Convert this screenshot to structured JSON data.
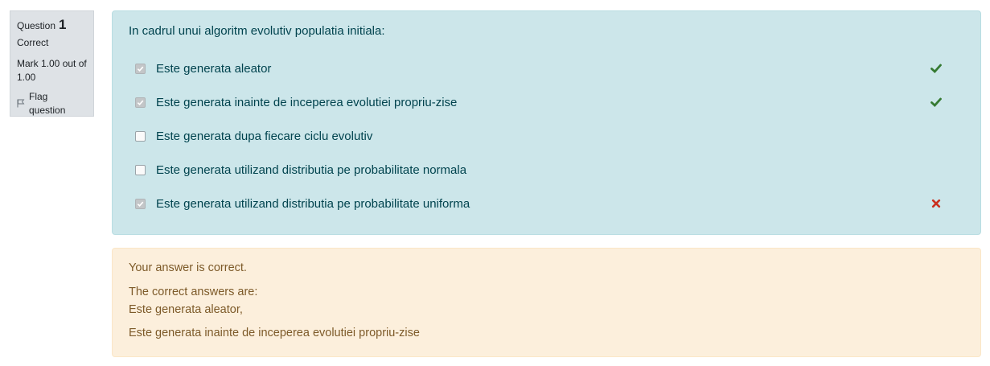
{
  "info": {
    "question_label": "Question",
    "question_number": "1",
    "state": "Correct",
    "grade": "Mark 1.00 out of 1.00",
    "flag_label": "Flag question"
  },
  "question": {
    "text": "In cadrul unui algoritm evolutiv populatia initiala:",
    "answers": [
      {
        "label": "Este generata aleator",
        "checked": true,
        "mark": "correct-icon"
      },
      {
        "label": "Este generata inainte de inceperea evolutiei propriu-zise",
        "checked": true,
        "mark": "correct-icon"
      },
      {
        "label": "Este generata dupa fiecare ciclu evolutiv",
        "checked": false,
        "mark": ""
      },
      {
        "label": "Este generata utilizand distributia pe probabilitate normala",
        "checked": false,
        "mark": ""
      },
      {
        "label": "Este generata utilizand distributia pe probabilitate uniforma",
        "checked": true,
        "mark": "incorrect-icon"
      }
    ]
  },
  "feedback": {
    "result": "Your answer is correct.",
    "correct_heading": "The correct answers are:",
    "correct_answer_1": "Este generata aleator,",
    "correct_answer_2": "Este generata inainte de inceperea evolutiei propriu-zise"
  },
  "colors": {
    "correct": "#357a32",
    "incorrect": "#ca3120",
    "question_bg": "#cce6ea",
    "feedback_bg": "#fcefdc",
    "info_bg": "#dee2e6"
  }
}
